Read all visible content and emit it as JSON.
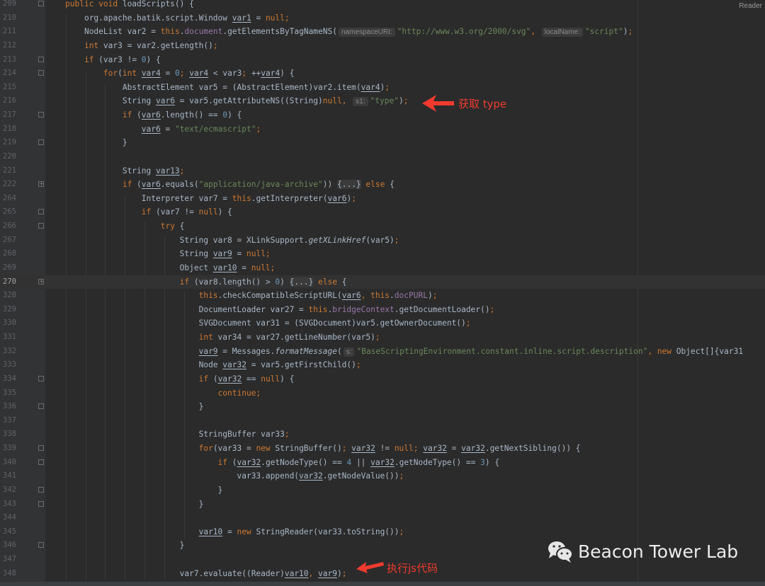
{
  "reader_label": "Reader",
  "annotations": {
    "get_type": "获取 type",
    "exec_js": "执行js代码"
  },
  "watermark": "Beacon Tower Lab",
  "current_line": "270",
  "lines": [
    {
      "n": "209",
      "ind": 0,
      "fold": "-",
      "t": [
        [
          "k",
          "public void "
        ],
        [
          "p",
          "loadScripts() {"
        ]
      ]
    },
    {
      "n": "210",
      "ind": 1,
      "t": [
        [
          "p",
          "org.apache.batik.script.Window "
        ],
        [
          "u",
          "var1"
        ],
        [
          "p",
          " = "
        ],
        [
          "k",
          "null;"
        ]
      ]
    },
    {
      "n": "211",
      "ind": 1,
      "t": [
        [
          "p",
          "NodeList var2 = "
        ],
        [
          "k",
          "this"
        ],
        [
          "p",
          "."
        ],
        [
          "f",
          "document"
        ],
        [
          "p",
          ".getElementsByTagNameNS("
        ],
        [
          "h",
          "namespaceURI:"
        ],
        [
          "s",
          "\"http://www.w3.org/2000/svg\""
        ],
        [
          "k",
          ", "
        ],
        [
          "h",
          "localName:"
        ],
        [
          "s",
          "\"script\""
        ],
        [
          "p",
          ")"
        ],
        [
          "k",
          ";"
        ]
      ]
    },
    {
      "n": "212",
      "ind": 1,
      "t": [
        [
          "k",
          "int "
        ],
        [
          "p",
          "var3 = var2.getLength()"
        ],
        [
          "k",
          ";"
        ]
      ]
    },
    {
      "n": "213",
      "ind": 1,
      "fold": "-",
      "t": [
        [
          "k",
          "if "
        ],
        [
          "p",
          "(var3 != "
        ],
        [
          "n",
          "0"
        ],
        [
          "p",
          ") {"
        ]
      ]
    },
    {
      "n": "214",
      "ind": 2,
      "fold": "-",
      "t": [
        [
          "k",
          "for"
        ],
        [
          "p",
          "("
        ],
        [
          "k",
          "int "
        ],
        [
          "u",
          "var4"
        ],
        [
          "p",
          " = "
        ],
        [
          "n",
          "0"
        ],
        [
          "k",
          "; "
        ],
        [
          "u",
          "var4"
        ],
        [
          "p",
          " < var3"
        ],
        [
          "k",
          "; "
        ],
        [
          "p",
          "++"
        ],
        [
          "u",
          "var4"
        ],
        [
          "p",
          ") {"
        ]
      ]
    },
    {
      "n": "215",
      "ind": 3,
      "t": [
        [
          "p",
          "AbstractElement var5 = (AbstractElement)var2.item("
        ],
        [
          "u",
          "var4"
        ],
        [
          "p",
          ")"
        ],
        [
          "k",
          ";"
        ]
      ]
    },
    {
      "n": "216",
      "ind": 3,
      "t": [
        [
          "p",
          "String "
        ],
        [
          "u",
          "var6"
        ],
        [
          "p",
          " = var5.getAttributeNS((String)"
        ],
        [
          "k",
          "null, "
        ],
        [
          "h",
          "s1:"
        ],
        [
          "s",
          "\"type\""
        ],
        [
          "p",
          ")"
        ],
        [
          "k",
          ";"
        ]
      ]
    },
    {
      "n": "217",
      "ind": 3,
      "fold": "-",
      "t": [
        [
          "k",
          "if "
        ],
        [
          "p",
          "("
        ],
        [
          "u",
          "var6"
        ],
        [
          "p",
          ".length() == "
        ],
        [
          "n",
          "0"
        ],
        [
          "p",
          ") {"
        ]
      ]
    },
    {
      "n": "218",
      "ind": 4,
      "t": [
        [
          "u",
          "var6"
        ],
        [
          "p",
          " = "
        ],
        [
          "s",
          "\"text/ecmascript\""
        ],
        [
          "k",
          ";"
        ]
      ]
    },
    {
      "n": "219",
      "ind": 3,
      "fold": "-",
      "t": [
        [
          "p",
          "}"
        ]
      ]
    },
    {
      "n": "220",
      "ind": 0,
      "t": []
    },
    {
      "n": "221",
      "ind": 3,
      "t": [
        [
          "p",
          "String "
        ],
        [
          "u",
          "var13"
        ],
        [
          "k",
          ";"
        ]
      ]
    },
    {
      "n": "222",
      "ind": 3,
      "fold": "+",
      "t": [
        [
          "k",
          "if "
        ],
        [
          "p",
          "("
        ],
        [
          "u",
          "var6"
        ],
        [
          "p",
          ".equals("
        ],
        [
          "s",
          "\"application/java-archive\""
        ],
        [
          "p",
          ")) "
        ],
        [
          "b",
          "{...}"
        ],
        [
          "k",
          " else "
        ],
        [
          "p",
          "{"
        ]
      ]
    },
    {
      "n": "264",
      "ind": 4,
      "t": [
        [
          "p",
          "Interpreter var7 = "
        ],
        [
          "k",
          "this"
        ],
        [
          "p",
          ".getInterpreter("
        ],
        [
          "u",
          "var6"
        ],
        [
          "p",
          ")"
        ],
        [
          "k",
          ";"
        ]
      ]
    },
    {
      "n": "265",
      "ind": 4,
      "fold": "-",
      "t": [
        [
          "k",
          "if "
        ],
        [
          "p",
          "(var7 != "
        ],
        [
          "k",
          "null"
        ],
        [
          "p",
          ") {"
        ]
      ]
    },
    {
      "n": "266",
      "ind": 5,
      "fold": "-",
      "t": [
        [
          "k",
          "try "
        ],
        [
          "p",
          "{"
        ]
      ]
    },
    {
      "n": "267",
      "ind": 6,
      "t": [
        [
          "p",
          "String var8 = XLinkSupport."
        ],
        [
          "i",
          "getXLinkHref"
        ],
        [
          "p",
          "(var5)"
        ],
        [
          "k",
          ";"
        ]
      ]
    },
    {
      "n": "268",
      "ind": 6,
      "t": [
        [
          "p",
          "String "
        ],
        [
          "u",
          "var9"
        ],
        [
          "p",
          " = "
        ],
        [
          "k",
          "null;"
        ]
      ]
    },
    {
      "n": "269",
      "ind": 6,
      "t": [
        [
          "p",
          "Object "
        ],
        [
          "u",
          "var10"
        ],
        [
          "p",
          " = "
        ],
        [
          "k",
          "null;"
        ]
      ]
    },
    {
      "n": "270",
      "ind": 6,
      "fold": "+",
      "t": [
        [
          "k",
          "if "
        ],
        [
          "p",
          "(var8.length() > "
        ],
        [
          "n",
          "0"
        ],
        [
          "p",
          ") "
        ],
        [
          "b",
          "{...}"
        ],
        [
          "k",
          " else "
        ],
        [
          "p",
          "{"
        ]
      ]
    },
    {
      "n": "328",
      "ind": 7,
      "t": [
        [
          "k",
          "this"
        ],
        [
          "p",
          ".checkCompatibleScriptURL("
        ],
        [
          "u",
          "var6"
        ],
        [
          "k",
          ", this"
        ],
        [
          "p",
          "."
        ],
        [
          "f",
          "docPURL"
        ],
        [
          "p",
          ")"
        ],
        [
          "k",
          ";"
        ]
      ]
    },
    {
      "n": "329",
      "ind": 7,
      "t": [
        [
          "p",
          "DocumentLoader var27 = "
        ],
        [
          "k",
          "this"
        ],
        [
          "p",
          "."
        ],
        [
          "f",
          "bridgeContext"
        ],
        [
          "p",
          ".getDocumentLoader()"
        ],
        [
          "k",
          ";"
        ]
      ]
    },
    {
      "n": "330",
      "ind": 7,
      "t": [
        [
          "p",
          "SVGDocument var31 = (SVGDocument)var5.getOwnerDocument()"
        ],
        [
          "k",
          ";"
        ]
      ]
    },
    {
      "n": "331",
      "ind": 7,
      "t": [
        [
          "k",
          "int "
        ],
        [
          "p",
          "var34 = var27.getLineNumber(var5)"
        ],
        [
          "k",
          ";"
        ]
      ]
    },
    {
      "n": "332",
      "ind": 7,
      "t": [
        [
          "u",
          "var9"
        ],
        [
          "p",
          " = Messages."
        ],
        [
          "i",
          "formatMessage"
        ],
        [
          "p",
          "("
        ],
        [
          "h",
          "s:"
        ],
        [
          "s",
          "\"BaseScriptingEnvironment.constant.inline.script.description\""
        ],
        [
          "k",
          ", new "
        ],
        [
          "p",
          "Object[]{var31"
        ]
      ]
    },
    {
      "n": "333",
      "ind": 7,
      "t": [
        [
          "p",
          "Node "
        ],
        [
          "u",
          "var32"
        ],
        [
          "p",
          " = var5.getFirstChild()"
        ],
        [
          "k",
          ";"
        ]
      ]
    },
    {
      "n": "334",
      "ind": 7,
      "fold": "-",
      "t": [
        [
          "k",
          "if "
        ],
        [
          "p",
          "("
        ],
        [
          "u",
          "var32"
        ],
        [
          "p",
          " == "
        ],
        [
          "k",
          "null"
        ],
        [
          "p",
          ") {"
        ]
      ]
    },
    {
      "n": "335",
      "ind": 8,
      "t": [
        [
          "k",
          "continue;"
        ]
      ]
    },
    {
      "n": "336",
      "ind": 7,
      "fold": "-",
      "t": [
        [
          "p",
          "}"
        ]
      ]
    },
    {
      "n": "337",
      "ind": 0,
      "t": []
    },
    {
      "n": "338",
      "ind": 7,
      "t": [
        [
          "p",
          "StringBuffer var33"
        ],
        [
          "k",
          ";"
        ]
      ]
    },
    {
      "n": "339",
      "ind": 7,
      "fold": "-",
      "t": [
        [
          "k",
          "for"
        ],
        [
          "p",
          "(var33 = "
        ],
        [
          "k",
          "new "
        ],
        [
          "p",
          "StringBuffer()"
        ],
        [
          "k",
          "; "
        ],
        [
          "u",
          "var32"
        ],
        [
          "p",
          " != "
        ],
        [
          "k",
          "null; "
        ],
        [
          "u",
          "var32"
        ],
        [
          "p",
          " = "
        ],
        [
          "u",
          "var32"
        ],
        [
          "p",
          ".getNextSibling()) {"
        ]
      ]
    },
    {
      "n": "340",
      "ind": 8,
      "fold": "-",
      "t": [
        [
          "k",
          "if "
        ],
        [
          "p",
          "("
        ],
        [
          "u",
          "var32"
        ],
        [
          "p",
          ".getNodeType() == "
        ],
        [
          "n",
          "4"
        ],
        [
          "p",
          " || "
        ],
        [
          "u",
          "var32"
        ],
        [
          "p",
          ".getNodeType() == "
        ],
        [
          "n",
          "3"
        ],
        [
          "p",
          ") {"
        ]
      ]
    },
    {
      "n": "341",
      "ind": 9,
      "t": [
        [
          "p",
          "var33.append("
        ],
        [
          "u",
          "var32"
        ],
        [
          "p",
          ".getNodeValue())"
        ],
        [
          "k",
          ";"
        ]
      ]
    },
    {
      "n": "342",
      "ind": 8,
      "fold": "-",
      "t": [
        [
          "p",
          "}"
        ]
      ]
    },
    {
      "n": "343",
      "ind": 7,
      "fold": "-",
      "t": [
        [
          "p",
          "}"
        ]
      ]
    },
    {
      "n": "344",
      "ind": 0,
      "t": []
    },
    {
      "n": "345",
      "ind": 7,
      "t": [
        [
          "u",
          "var10"
        ],
        [
          "p",
          " = "
        ],
        [
          "k",
          "new "
        ],
        [
          "p",
          "StringReader(var33.toString())"
        ],
        [
          "k",
          ";"
        ]
      ]
    },
    {
      "n": "346",
      "ind": 6,
      "fold": "-",
      "t": [
        [
          "p",
          "}"
        ]
      ]
    },
    {
      "n": "347",
      "ind": 0,
      "t": []
    },
    {
      "n": "348",
      "ind": 6,
      "t": [
        [
          "p",
          "var7.evaluate((Reader)"
        ],
        [
          "u",
          "var10"
        ],
        [
          "k",
          ", "
        ],
        [
          "u",
          "var9"
        ],
        [
          "p",
          ")"
        ],
        [
          "k",
          ";"
        ]
      ]
    }
  ]
}
